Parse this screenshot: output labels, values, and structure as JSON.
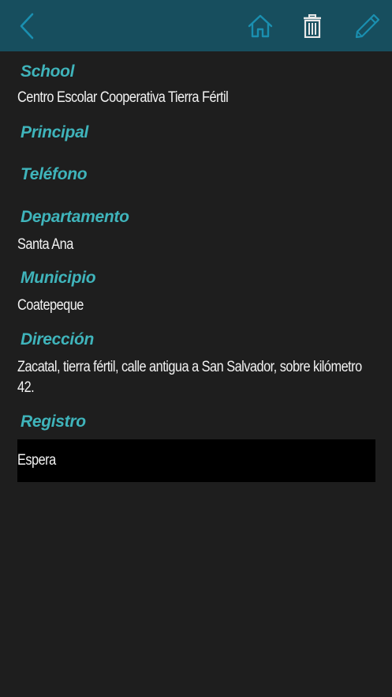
{
  "toolbar": {
    "back_icon": "chevron-left-icon",
    "home_icon": "home-icon",
    "delete_icon": "trash-icon",
    "edit_icon": "pencil-icon",
    "accent_color": "#1a8fb0"
  },
  "fields": {
    "school": {
      "label": "School",
      "value": "Centro Escolar Cooperativa Tierra Fértil"
    },
    "principal": {
      "label": "Principal",
      "value": ""
    },
    "telefono": {
      "label": "Teléfono",
      "value": ""
    },
    "departamento": {
      "label": "Departamento",
      "value": "Santa Ana"
    },
    "municipio": {
      "label": "Municipio",
      "value": "Coatepeque"
    },
    "direccion": {
      "label": "Dirección",
      "value": "Zacatal, tierra fértil, calle antigua a San Salvador, sobre kilómetro 42."
    },
    "registro": {
      "label": "Registro",
      "value": "Espera"
    }
  },
  "colors": {
    "header_bg": "#174e5e",
    "page_bg": "#1e1e1e",
    "label": "#3fb4bb",
    "value": "#f2f2f2"
  }
}
